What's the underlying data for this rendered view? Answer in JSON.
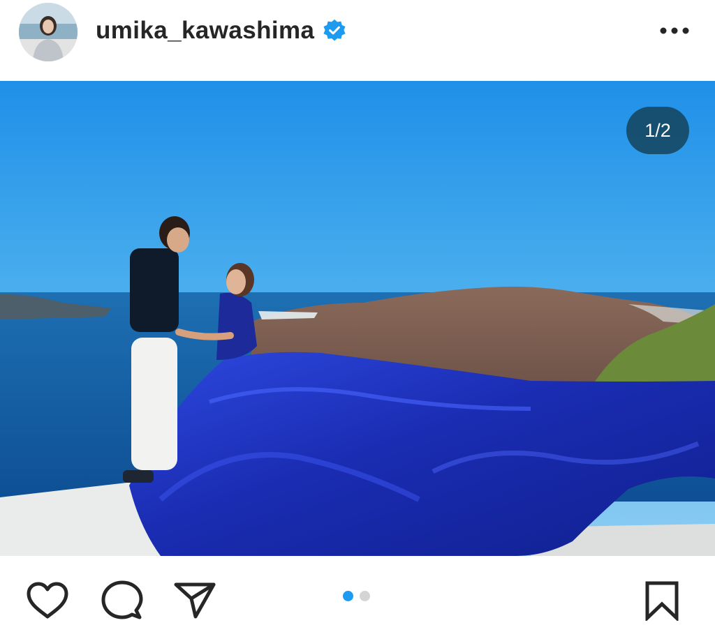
{
  "post": {
    "username": "umika_kawashima",
    "verified": true,
    "image_counter": "1/2",
    "current_image": 1,
    "total_images": 2
  },
  "icons": {
    "more": "more-horizontal-icon",
    "like": "heart-icon",
    "comment": "comment-icon",
    "share": "send-icon",
    "save": "bookmark-icon",
    "verified": "verified-badge-icon"
  },
  "colors": {
    "verified_blue": "#1d9bf0",
    "dot_active": "#1d9bf0",
    "dot_inactive": "#d4d4d4",
    "text": "#262626",
    "dress_blue": "#1f2fb8"
  }
}
